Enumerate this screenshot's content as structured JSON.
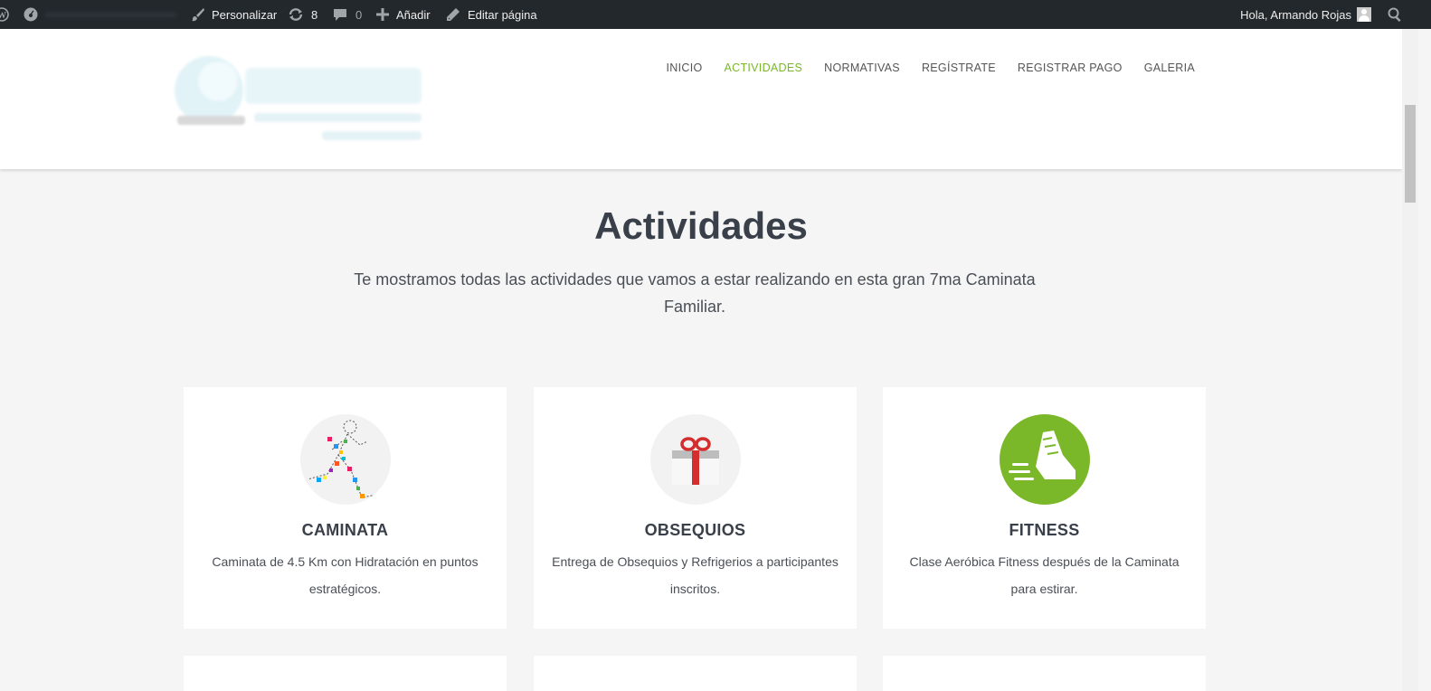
{
  "admin_bar": {
    "customize_label": "Personalizar",
    "updates_count": "8",
    "comments_count": "0",
    "add_label": "Añadir",
    "edit_label": "Editar página",
    "greeting": "Hola, Armando Rojas"
  },
  "nav": {
    "items": [
      {
        "label": "INICIO"
      },
      {
        "label": "ACTIVIDADES"
      },
      {
        "label": "NORMATIVAS"
      },
      {
        "label": "REGÍSTRATE"
      },
      {
        "label": "REGISTRAR PAGO"
      },
      {
        "label": "GALERIA"
      }
    ],
    "active_color": "#7ab829"
  },
  "section": {
    "title": "Actividades",
    "subtitle": "Te mostramos todas las actividades que vamos a estar realizando en esta gran 7ma Caminata Familiar."
  },
  "cards": [
    {
      "title": "CAMINATA",
      "description": "Caminata de 4.5 Km con Hidratación en puntos estratégicos.",
      "icon": "runner-icon"
    },
    {
      "title": "OBSEQUIOS",
      "description": "Entrega de Obsequios y Refrigerios a participantes inscritos.",
      "icon": "gift-icon"
    },
    {
      "title": "FITNESS",
      "description": "Clase Aeróbica Fitness después de la Caminata para estirar.",
      "icon": "sneaker-icon"
    }
  ],
  "colors": {
    "admin_bar_bg": "#23282d",
    "fitness_green": "#7ab829",
    "gift_red": "#d32f2f"
  }
}
